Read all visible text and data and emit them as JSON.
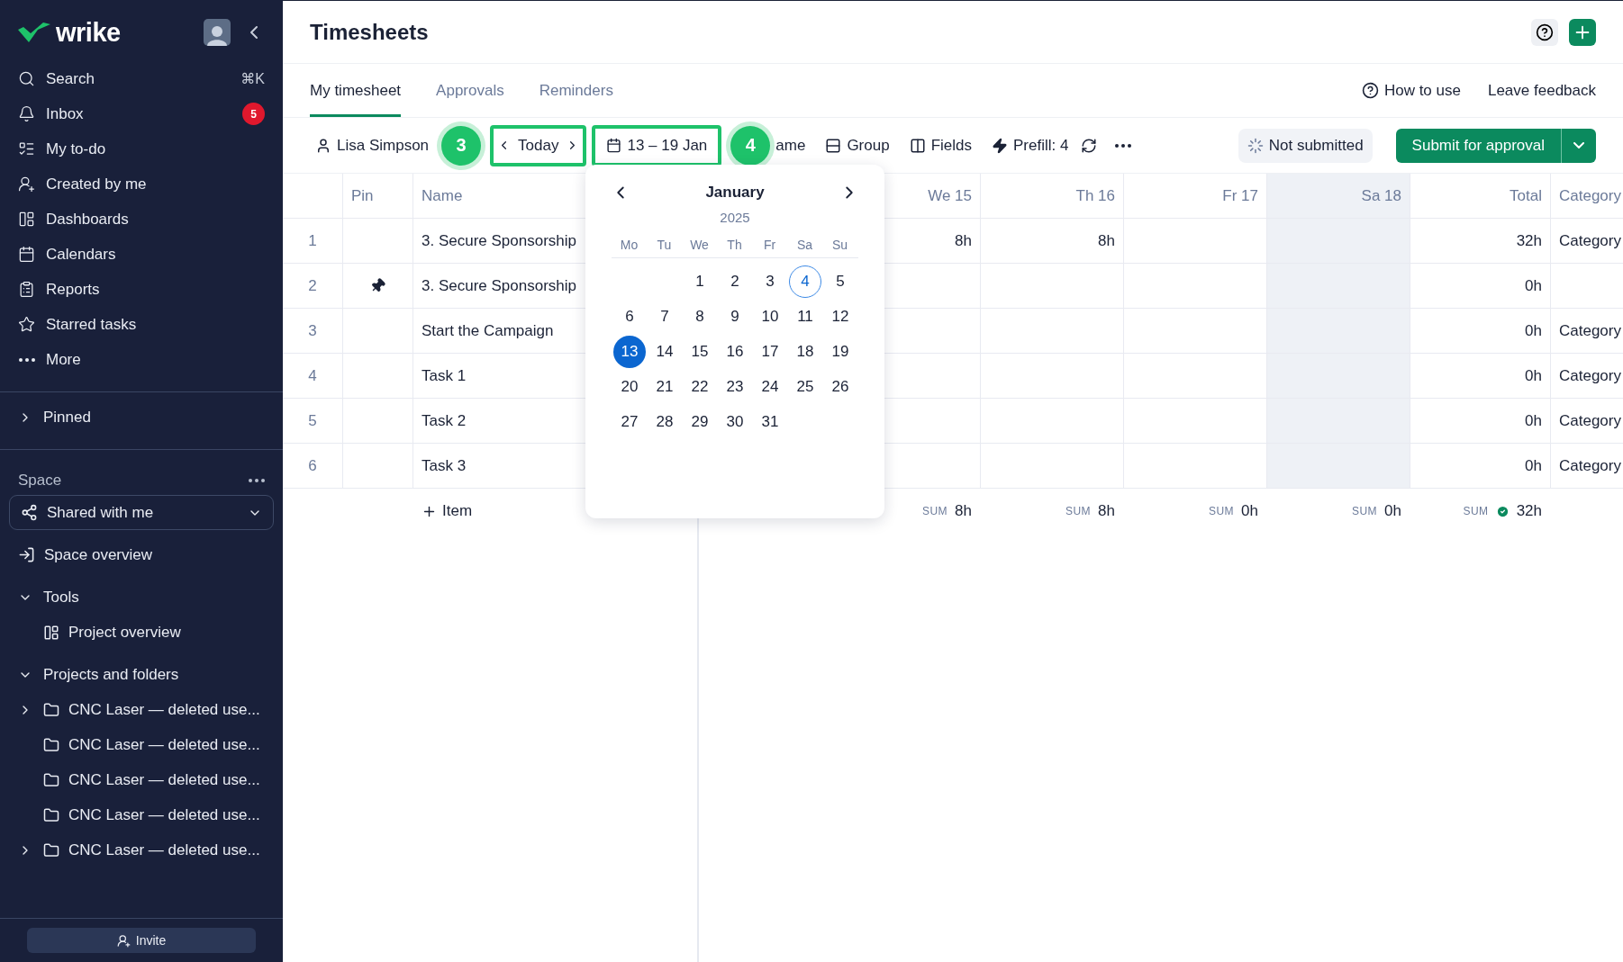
{
  "sidebar": {
    "logo": "wrike",
    "nav": [
      {
        "label": "Search",
        "shortcut": "⌘K"
      },
      {
        "label": "Inbox",
        "count": "5"
      },
      {
        "label": "My to-do"
      },
      {
        "label": "Created by me"
      },
      {
        "label": "Dashboards"
      },
      {
        "label": "Calendars"
      },
      {
        "label": "Reports"
      },
      {
        "label": "Starred tasks"
      },
      {
        "label": "More"
      }
    ],
    "pinned": {
      "label": "Pinned",
      "expanded": false
    },
    "space": {
      "heading": "Space",
      "selector": "Shared with me",
      "overview": "Space overview"
    },
    "tools": {
      "label": "Tools",
      "expanded": true,
      "items": [
        "Project overview"
      ]
    },
    "projects": {
      "label": "Projects and folders",
      "expanded": true,
      "items": [
        {
          "label": "CNC Laser — deleted use...",
          "expandable": true
        },
        {
          "label": "CNC Laser — deleted use...",
          "expandable": false
        },
        {
          "label": "CNC Laser — deleted use...",
          "expandable": false
        },
        {
          "label": "CNC Laser — deleted use...",
          "expandable": false
        },
        {
          "label": "CNC Laser — deleted use...",
          "expandable": true
        }
      ]
    },
    "invite": "Invite"
  },
  "header": {
    "title": "Timesheets"
  },
  "tabs": [
    {
      "label": "My timesheet",
      "selected": true
    },
    {
      "label": "Approvals",
      "selected": false
    },
    {
      "label": "Reminders",
      "selected": false
    }
  ],
  "tab_links": [
    "How to use",
    "Leave feedback"
  ],
  "toolbar": {
    "user": "Lisa Simpson",
    "today": "Today",
    "range": "13 – 19 Jan",
    "name_partial": "ame",
    "group": "Group",
    "fields": "Fields",
    "prefill": "Prefill: 4",
    "status": "Not submitted",
    "submit": "Submit for approval"
  },
  "annotations": [
    {
      "label": "3"
    },
    {
      "label": "4"
    }
  ],
  "table": {
    "columns": {
      "pin": "Pin",
      "name": "Name",
      "days": [
        {
          "label": "We 15",
          "weekend": false
        },
        {
          "label": "Th 16",
          "weekend": false
        },
        {
          "label": "Fr 17",
          "weekend": false
        },
        {
          "label": "Sa 18",
          "weekend": true
        }
      ],
      "total": "Total",
      "category": "Category"
    },
    "rows": [
      {
        "index": "1",
        "pinned": false,
        "name": "3. Secure Sponsorship",
        "hours": [
          "8h",
          "8h"
        ],
        "total": "32h",
        "category": "Category"
      },
      {
        "index": "2",
        "pinned": true,
        "name": "3. Secure Sponsorship",
        "total": "0h"
      },
      {
        "index": "3",
        "pinned": false,
        "name": "Start the Campaign",
        "total": "0h",
        "category": "Category"
      },
      {
        "index": "4",
        "pinned": false,
        "name": "Task 1",
        "total": "0h",
        "category": "Category"
      },
      {
        "index": "5",
        "pinned": false,
        "name": "Task 2",
        "total": "0h",
        "category": "Category"
      },
      {
        "index": "6",
        "pinned": false,
        "name": "Task 3",
        "total": "0h",
        "category": "Category"
      }
    ],
    "add_item": "Item",
    "sums": [
      {
        "label": "SUM",
        "value": "8h",
        "complete": false
      },
      {
        "label": "SUM",
        "value": "8h",
        "complete": false
      },
      {
        "label": "SUM",
        "value": "0h",
        "complete": false
      },
      {
        "label": "SUM",
        "value": "0h",
        "complete": false
      }
    ],
    "total_sum": {
      "label": "SUM",
      "value": "32h",
      "complete": true
    }
  },
  "calendar": {
    "month": "January",
    "year": "2025",
    "weekdays": [
      "Mo",
      "Tu",
      "We",
      "Th",
      "Fr",
      "Sa",
      "Su"
    ],
    "weeks": [
      [
        {
          "label": "1",
          "selected": false,
          "today": false
        },
        {
          "label": "2",
          "selected": false,
          "today": false
        },
        {
          "label": "3",
          "selected": false,
          "today": false
        },
        {
          "label": "4",
          "selected": false,
          "today": true
        },
        {
          "label": "5",
          "selected": false,
          "today": false
        }
      ],
      [
        {
          "label": "6",
          "selected": false,
          "today": false
        },
        {
          "label": "7",
          "selected": false,
          "today": false
        },
        {
          "label": "8",
          "selected": false,
          "today": false
        },
        {
          "label": "9",
          "selected": false,
          "today": false
        },
        {
          "label": "10",
          "selected": false,
          "today": false
        },
        {
          "label": "11",
          "selected": false,
          "today": false
        },
        {
          "label": "12",
          "selected": false,
          "today": false
        }
      ],
      [
        {
          "label": "13",
          "selected": true,
          "today": false
        },
        {
          "label": "14",
          "selected": false,
          "today": false
        },
        {
          "label": "15",
          "selected": false,
          "today": false
        },
        {
          "label": "16",
          "selected": false,
          "today": false
        },
        {
          "label": "17",
          "selected": false,
          "today": false
        },
        {
          "label": "18",
          "selected": false,
          "today": false
        },
        {
          "label": "19",
          "selected": false,
          "today": false
        }
      ],
      [
        {
          "label": "20",
          "selected": false,
          "today": false
        },
        {
          "label": "21",
          "selected": false,
          "today": false
        },
        {
          "label": "22",
          "selected": false,
          "today": false
        },
        {
          "label": "23",
          "selected": false,
          "today": false
        },
        {
          "label": "24",
          "selected": false,
          "today": false
        },
        {
          "label": "25",
          "selected": false,
          "today": false
        },
        {
          "label": "26",
          "selected": false,
          "today": false
        }
      ],
      [
        {
          "label": "27",
          "selected": false,
          "today": false
        },
        {
          "label": "28",
          "selected": false,
          "today": false
        },
        {
          "label": "29",
          "selected": false,
          "today": false
        },
        {
          "label": "30",
          "selected": false,
          "today": false
        },
        {
          "label": "31",
          "selected": false,
          "today": false
        }
      ]
    ]
  }
}
